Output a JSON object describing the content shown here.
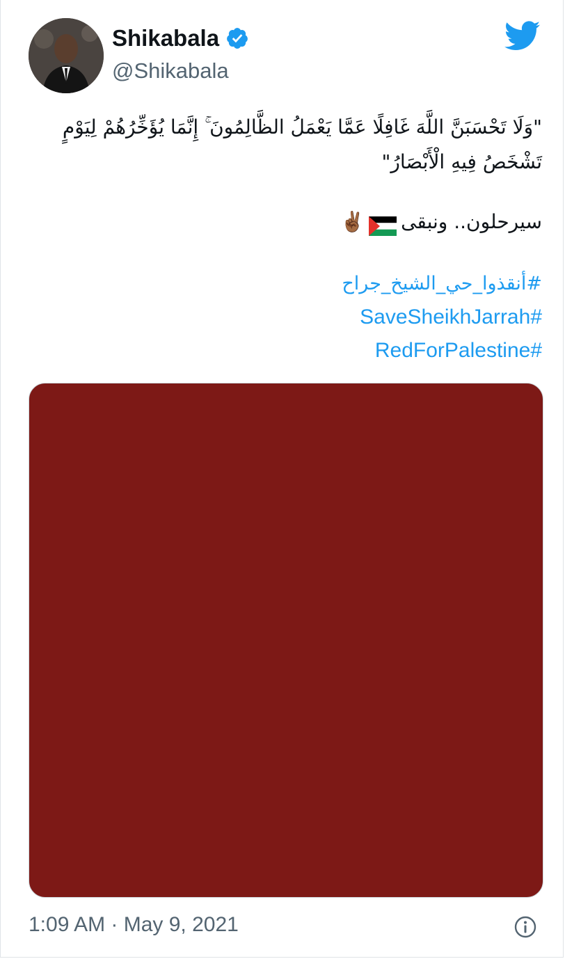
{
  "tweet": {
    "display_name": "Shikabala",
    "handle": "@Shikabala",
    "verified_icon": "verified-badge-icon",
    "logo_icon": "twitter-bird-icon",
    "quote_text": "\"وَلَا تَحْسَبَنَّ اللَّهَ غَافِلًا عَمَّا يَعْمَلُ الظَّالِمُونَ ۚ إِنَّمَا يُؤَخِّرُهُمْ لِيَوْمٍ تَشْخَصُ فِيهِ الْأَبْصَارُ\"",
    "line2_text": "سيرحلون.. ونبقى",
    "flag_icon": "palestine-flag-icon",
    "peace_emoji": "✌🏾",
    "hashtags": [
      "#أنقذوا_حي_الشيخ_جراح",
      "#SaveSheikhJarrah",
      "#RedForPalestine"
    ],
    "media_color": "#7d1916",
    "timestamp": "1:09 AM · May 9, 2021",
    "info_icon": "info-icon"
  },
  "colors": {
    "link": "#1d9bf0",
    "secondary_text": "#536471",
    "verified": "#1d9bf0",
    "palestine_black": "#000000",
    "palestine_white": "#ffffff",
    "palestine_green": "#149954",
    "palestine_red": "#e4312b"
  }
}
